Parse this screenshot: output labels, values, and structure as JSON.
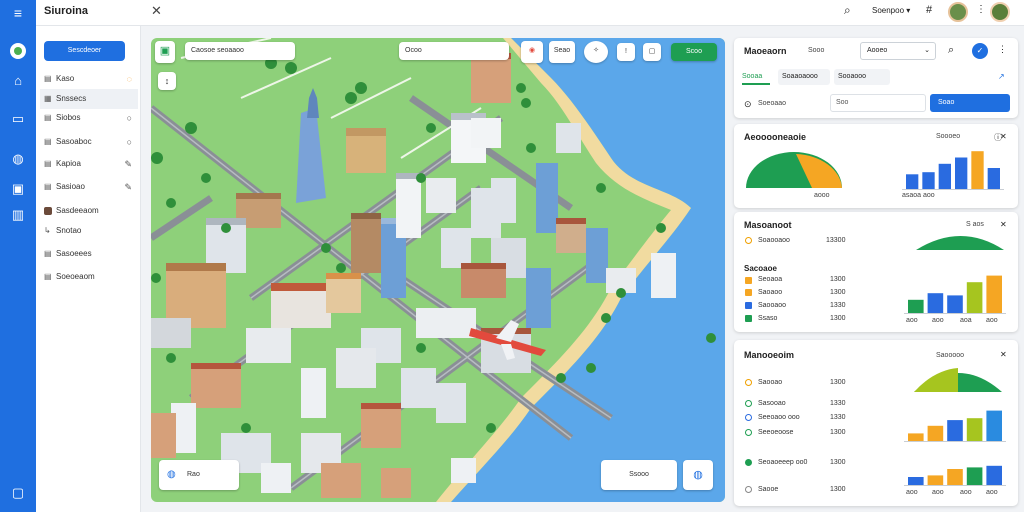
{
  "app": {
    "title": "Siuroina"
  },
  "topbar": {
    "search_label": "Soenpoo ▾"
  },
  "sidebar": {
    "primary_button": "Sescdeoer",
    "items": [
      {
        "label": "Kaso"
      },
      {
        "label": "Snssecs"
      },
      {
        "label": "Siobos"
      },
      {
        "label": "Sasoaboc"
      },
      {
        "label": "Kapioa"
      },
      {
        "label": "Sasioao"
      },
      {
        "label": "Sasdeeaom"
      },
      {
        "label": "Snotao"
      },
      {
        "label": "Sasoeees"
      },
      {
        "label": "Soeoeaom"
      }
    ]
  },
  "map": {
    "location_label": "Caosoe seoaaoo",
    "toolbar_label": "Ocoo",
    "share_label": "Seao",
    "go_label": "Scoo",
    "bottom_left_label": "Rao",
    "bottom_right_label": "Ssooo"
  },
  "right": {
    "header": {
      "title": "Maoeaorn",
      "sub": "Sooo",
      "filter": "Aooeo"
    },
    "tabs": [
      "Sooaa",
      "Soaaoaooo",
      "Sooaooo"
    ],
    "search": {
      "label": "Soeoaao",
      "field": "Soo",
      "button": "Soao"
    },
    "card1": {
      "title": "Aeooooneaoie",
      "meta": "Soooeo",
      "labels_a": "aooo",
      "labels_b": "asaoa aoo"
    },
    "card2": {
      "title": "Masoanoot",
      "meta": "S  aos",
      "rows": [
        {
          "label": "Soaooaoo",
          "value": "13300"
        }
      ],
      "subtitle": "Sacoaoe",
      "rows2": [
        {
          "label": "Seoaoa",
          "value": "1300"
        },
        {
          "label": "Saoaoo",
          "value": "1300"
        },
        {
          "label": "Saooaoo",
          "value": "1330"
        },
        {
          "label": "Ssaso",
          "value": "1300"
        }
      ],
      "bar_labels": [
        "aoo",
        "aoo",
        "aoa",
        "aoo"
      ]
    },
    "card3": {
      "title": "Manooeoim",
      "meta": "Saooooo",
      "rows": [
        {
          "label": "Saooao",
          "value": "1300"
        },
        {
          "label": "Sasooao",
          "value": "1330"
        },
        {
          "label": "Seeoaoo ooo",
          "value": "1330"
        },
        {
          "label": "Seeoeoose",
          "value": "1300"
        },
        {
          "label": "Seoaoeeep oo0",
          "value": "1300"
        },
        {
          "label": "Saooe",
          "value": "1300"
        }
      ],
      "bar_labels": [
        "aoo",
        "aoo",
        "aoo",
        "aoo"
      ]
    }
  },
  "chart_data": [
    {
      "type": "bar",
      "series": [
        {
          "values": [
            0.35,
            0.4,
            0.6,
            0.75,
            0.9,
            0.5
          ]
        }
      ],
      "colors": [
        "#2a6be0",
        "#2a6be0",
        "#2a6be0",
        "#2a6be0",
        "#f5a623",
        "#2a6be0"
      ]
    },
    {
      "type": "bar",
      "series": [
        {
          "values": [
            0.3,
            0.45,
            0.4,
            0.7,
            0.85
          ]
        }
      ],
      "colors": [
        "#1e9e52",
        "#2a6be0",
        "#2a6be0",
        "#a6c51f",
        "#f5a623"
      ]
    },
    {
      "type": "bar",
      "series": [
        {
          "values": [
            0.2,
            0.4,
            0.55,
            0.6,
            0.8
          ]
        }
      ],
      "colors": [
        "#f5a623",
        "#f5a623",
        "#2a6be0",
        "#a6c51f",
        "#2a8be0"
      ]
    },
    {
      "type": "bar",
      "series": [
        {
          "values": [
            0.25,
            0.3,
            0.5,
            0.55,
            0.6
          ]
        }
      ],
      "colors": [
        "#2a6be0",
        "#f5a623",
        "#f5a623",
        "#1e9e52",
        "#2a6be0"
      ]
    }
  ]
}
